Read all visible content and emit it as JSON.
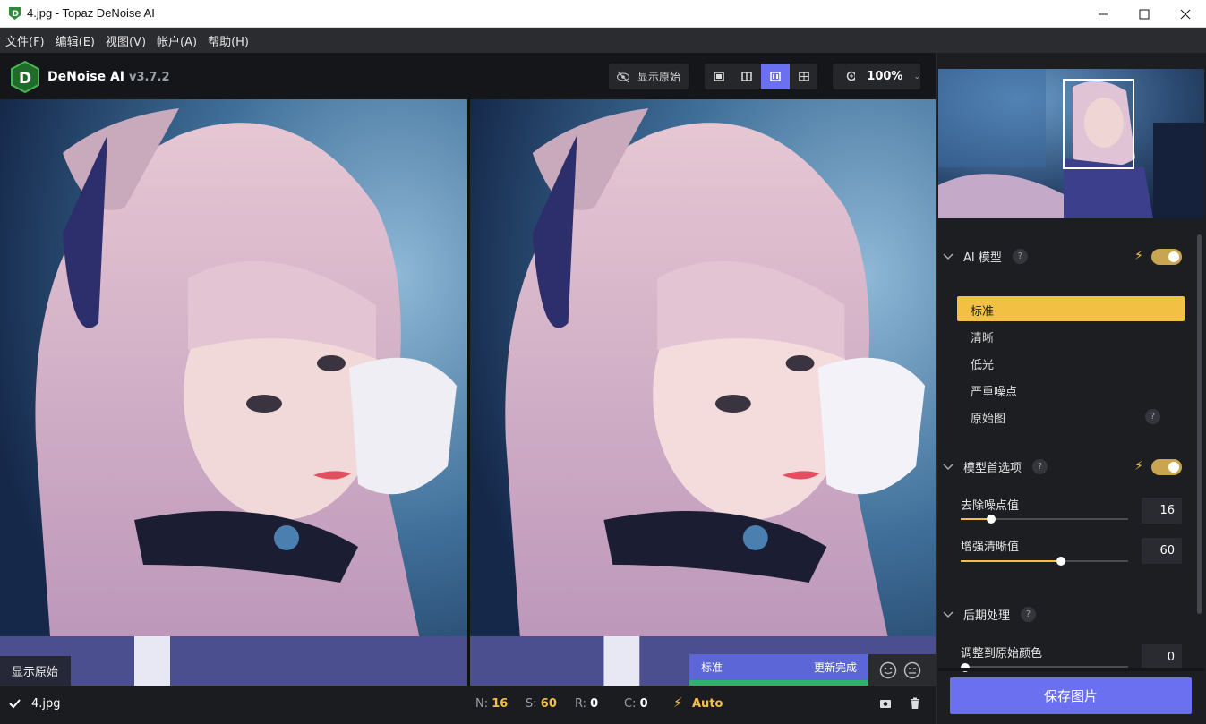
{
  "window": {
    "title": "4.jpg - Topaz DeNoise AI"
  },
  "menu": [
    "文件(F)",
    "编辑(E)",
    "视图(V)",
    "帐户(A)",
    "帮助(H)"
  ],
  "brand": {
    "name": "DeNoise AI",
    "version": "v3.7.2"
  },
  "toolbar": {
    "show_original": "显示原始",
    "zoom": "100%"
  },
  "image_overlay": {
    "show_original": "显示原始",
    "status_left": "标准",
    "status_right": "更新完成"
  },
  "bottom": {
    "filename": "4.jpg",
    "stats": [
      {
        "k": "N:",
        "v": "16"
      },
      {
        "k": "S:",
        "v": "60"
      },
      {
        "k": "R:",
        "v": "0"
      },
      {
        "k": "C:",
        "v": "0"
      }
    ],
    "auto": "Auto"
  },
  "panel": {
    "ai_model": {
      "title": "AI 模型",
      "help": "?",
      "enabled": true
    },
    "models": [
      "标准",
      "清晰",
      "低光",
      "严重噪点",
      "原始图"
    ],
    "selected_model": "标准",
    "model_prefs": {
      "title": "模型首选项",
      "help": "?",
      "enabled": true
    },
    "sliders": [
      {
        "label": "去除噪点值",
        "value": "16",
        "fraction": 0.18
      },
      {
        "label": "增强清晰值",
        "value": "60",
        "fraction": 0.6
      }
    ],
    "post": {
      "title": "后期处理",
      "help": "?"
    },
    "color": {
      "label": "调整到原始颜色",
      "value": "0",
      "fraction": 0.0
    },
    "save": "保存图片"
  },
  "colors": {
    "accent": "#f2c144",
    "primary": "#6b70f0",
    "status_bar": "#5d66d6",
    "status_ok": "#2bb56b"
  }
}
